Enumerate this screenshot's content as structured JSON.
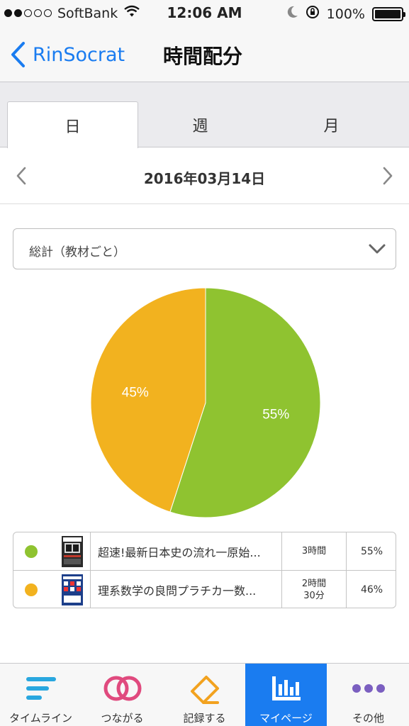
{
  "status_bar": {
    "carrier": "SoftBank",
    "time": "12:06 AM",
    "battery": "100%"
  },
  "nav": {
    "back_label": "RinSocrat",
    "title": "時間配分"
  },
  "tabs": [
    {
      "label": "日",
      "active": true
    },
    {
      "label": "週",
      "active": false
    },
    {
      "label": "月",
      "active": false
    }
  ],
  "date": "2016年03月14日",
  "select": {
    "value": "総計（教材ごと）"
  },
  "chart_data": {
    "type": "pie",
    "slices": [
      {
        "label": "超速!最新日本史の流れ一原始...",
        "value": 55,
        "display": "55%",
        "color": "#8fc330"
      },
      {
        "label": "理系数学の良問プラチカ一数...",
        "value": 45,
        "display": "45%",
        "color": "#f2b21f"
      }
    ]
  },
  "legend": [
    {
      "title": "超速!最新日本史の流れ一原始...",
      "time": "3時間",
      "percent": "55%",
      "color": "#8fc330"
    },
    {
      "title": "理系数学の良問プラチカ一数...",
      "time": "2時間\n30分",
      "percent": "46%",
      "color": "#f2b21f"
    }
  ],
  "tab_bar": [
    {
      "label": "タイムライン",
      "icon": "timeline-icon",
      "active": false
    },
    {
      "label": "つながる",
      "icon": "connect-rings-icon",
      "active": false
    },
    {
      "label": "記録する",
      "icon": "record-pencil-icon",
      "active": false
    },
    {
      "label": "マイページ",
      "icon": "chart-bars-icon",
      "active": true
    },
    {
      "label": "その他",
      "icon": "more-dots-icon",
      "active": false
    }
  ],
  "colors": {
    "accent": "#1a7cf0",
    "green": "#8fc330",
    "orange": "#f2b21f",
    "pink": "#e04a7e",
    "purple": "#7b5fc0"
  }
}
